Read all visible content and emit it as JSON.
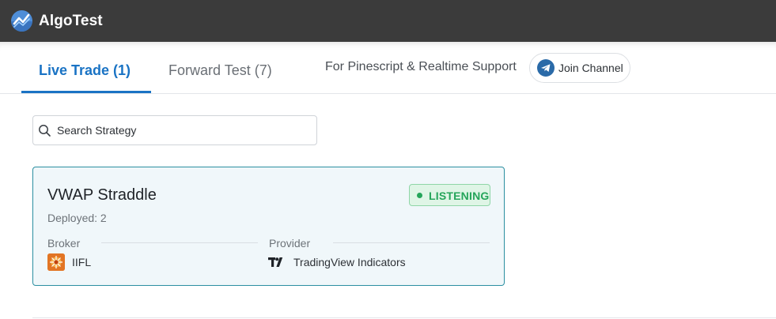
{
  "app": {
    "title": "AlgoTest",
    "logo_icon": "trend-chart-logo-icon"
  },
  "tabs": [
    {
      "label": "Live Trade (1)",
      "active": true
    },
    {
      "label": "Forward Test (7)",
      "active": false
    }
  ],
  "support": {
    "text": "For Pinescript & Realtime Support",
    "button_label": "Join Channel",
    "button_icon": "telegram-icon"
  },
  "search": {
    "placeholder": "Search Strategy",
    "value": ""
  },
  "strategies": [
    {
      "name": "VWAP Straddle",
      "status": "LISTENING",
      "deployed": "Deployed: 2",
      "broker_heading": "Broker",
      "broker_name": "IIFL",
      "provider_heading": "Provider",
      "provider_name": "TradingView Indicators"
    }
  ],
  "colors": {
    "topbar": "#3b3b3b",
    "accent": "#1a73c4",
    "card_border": "#2b8fa1",
    "status_green": "#25a55a"
  }
}
